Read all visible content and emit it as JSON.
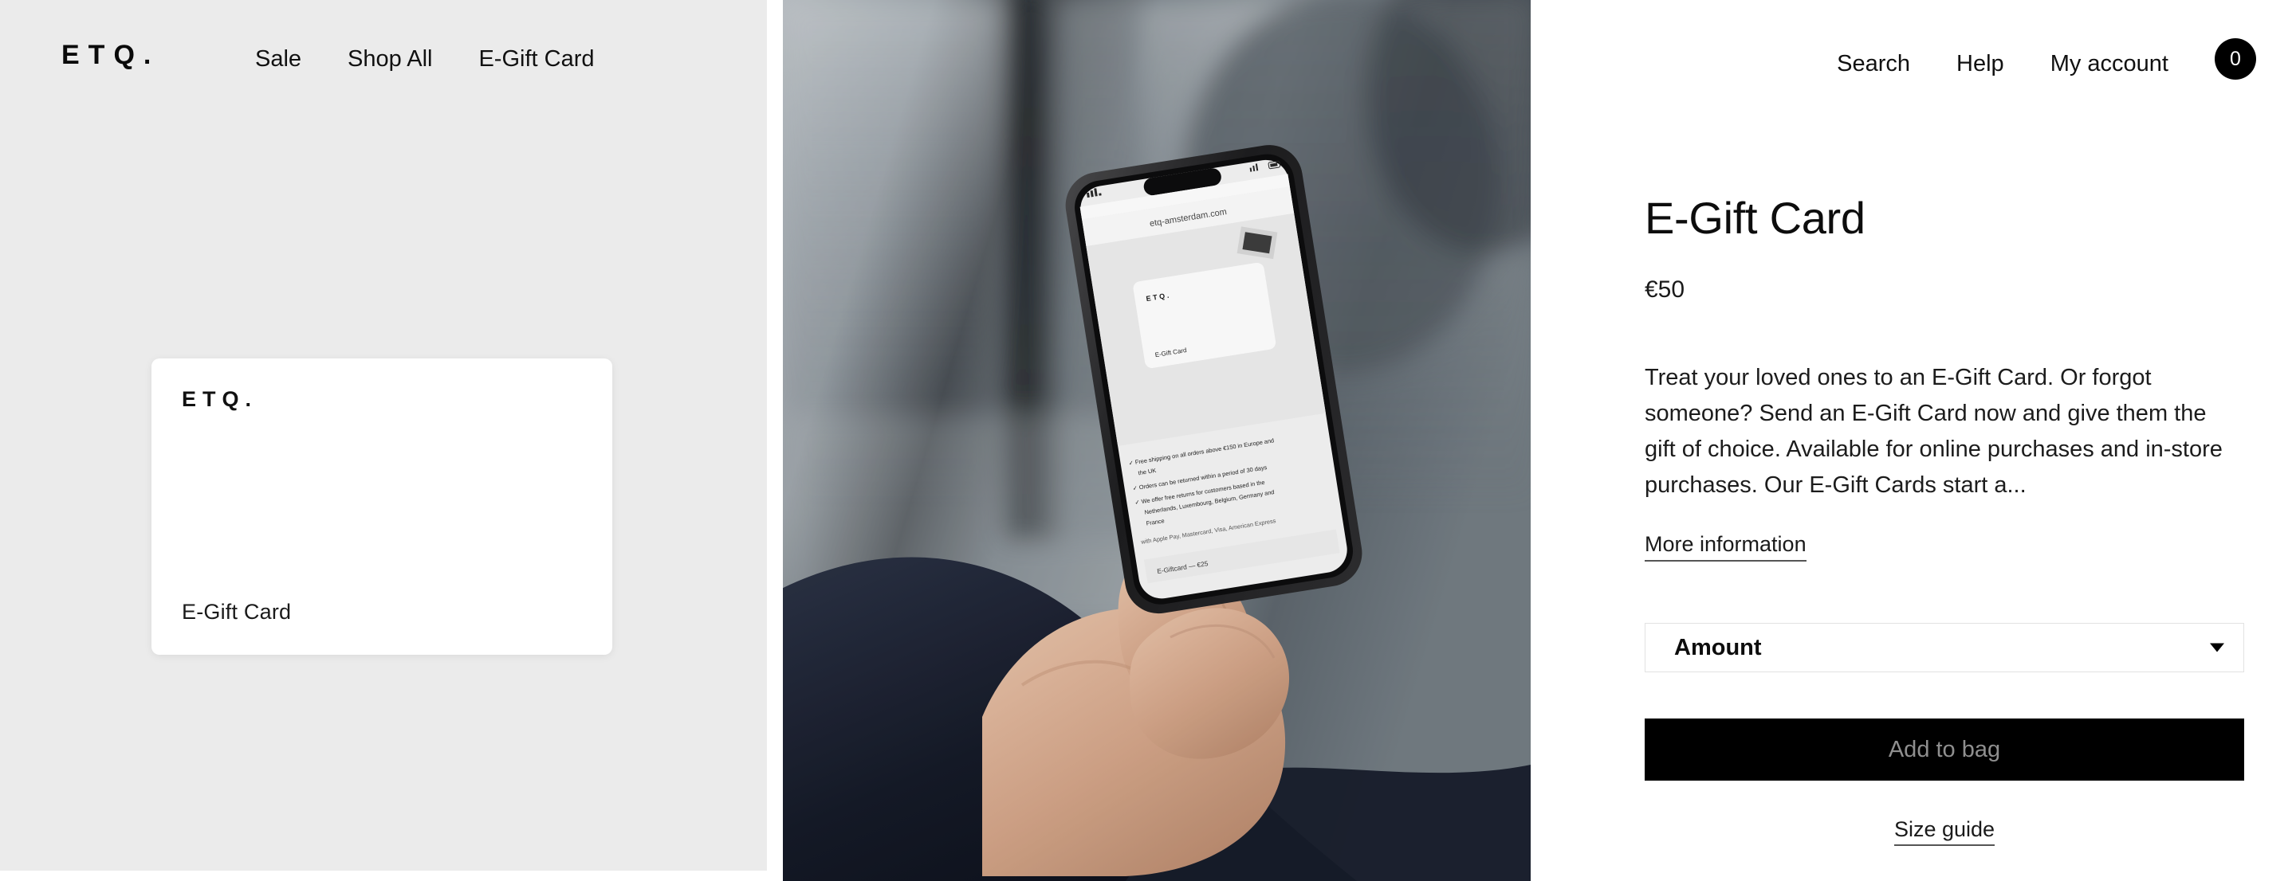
{
  "header": {
    "brand": "ETQ.",
    "nav_left": [
      {
        "label": "Sale",
        "name": "nav-sale"
      },
      {
        "label": "Shop All",
        "name": "nav-shop-all"
      },
      {
        "label": "E-Gift Card",
        "name": "nav-e-gift-card"
      }
    ],
    "nav_right": [
      {
        "label": "Search",
        "name": "nav-search"
      },
      {
        "label": "Help",
        "name": "nav-help"
      },
      {
        "label": "My account",
        "name": "nav-my-account"
      }
    ],
    "cart_count": "0"
  },
  "gallery": {
    "card": {
      "logo": "ETQ.",
      "caption": "E-Gift Card"
    },
    "photo": {
      "alt": "Hand holding a smartphone showing the etq-amsterdam.com E-Gift Card page",
      "phone_url_bar": "etq-amsterdam.com",
      "phone_card_logo": "ETQ.",
      "phone_card_caption": "E-Gift Card",
      "phone_bullets": [
        "Free shipping on all orders above €150 in Europe and the UK",
        "Orders can be returned within a period of 30 days",
        "We offer free returns for customers based in the Netherlands, Luxembourg, Belgium, Germany and France"
      ],
      "phone_payments": "with Apple Pay, Mastercard, Visa, American Express",
      "phone_product_line": "E-Giftcard — €25"
    }
  },
  "product": {
    "title": "E-Gift Card",
    "price": "€50",
    "description": "Treat your loved ones to an E-Gift Card. Or forgot someone? Send an E-Gift Card now and give them the gift of choice. Available for online purchases and in-store purchases. Our E-Gift Cards start a...",
    "more_information_label": "More information",
    "amount_label": "Amount",
    "add_to_bag_label": "Add to bag",
    "size_guide_label": "Size guide"
  },
  "colors": {
    "panel_bg": "#ebebeb",
    "page_bg": "#ffffff",
    "text": "#111111",
    "button_bg": "#000000",
    "button_text_disabled": "#8f8f8f",
    "border": "#e2e2e2"
  }
}
